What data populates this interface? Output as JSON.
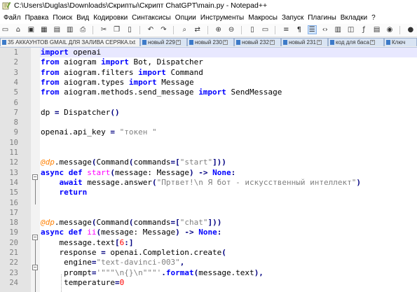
{
  "window": {
    "title": "C:\\Users\\Duglas\\Downloads\\Скрипты\\Скрипт ChatGPT\\main.py - Notepad++"
  },
  "menu": [
    "Файл",
    "Правка",
    "Поиск",
    "Вид",
    "Кодировки",
    "Синтаксисы",
    "Опции",
    "Инструменты",
    "Макросы",
    "Запуск",
    "Плагины",
    "Вкладки",
    "?"
  ],
  "tabs": [
    {
      "label": "35 АККАУНТОВ GMAIL ДЛЯ ЗАЛИВА СЕРЯКА.txt"
    },
    {
      "label": "новый 229"
    },
    {
      "label": "новый 230"
    },
    {
      "label": "новый 232"
    },
    {
      "label": "новый 231"
    },
    {
      "label": "код для баса"
    },
    {
      "label": "Ключ"
    }
  ],
  "editor": {
    "current_line": 1,
    "lines": [
      {
        "n": "1",
        "segs": [
          [
            "kw",
            "import"
          ],
          [
            "id",
            " openai"
          ]
        ]
      },
      {
        "n": "2",
        "segs": [
          [
            "kw",
            "from"
          ],
          [
            "id",
            " aiogram "
          ],
          [
            "kw",
            "import"
          ],
          [
            "id",
            " Bot, Dispatcher"
          ]
        ]
      },
      {
        "n": "3",
        "segs": [
          [
            "kw",
            "from"
          ],
          [
            "id",
            " aiogram.filters "
          ],
          [
            "kw",
            "import"
          ],
          [
            "id",
            " Command"
          ]
        ]
      },
      {
        "n": "4",
        "segs": [
          [
            "kw",
            "from"
          ],
          [
            "id",
            " aiogram.types "
          ],
          [
            "kw",
            "import"
          ],
          [
            "id",
            " Message"
          ]
        ]
      },
      {
        "n": "5",
        "segs": [
          [
            "kw",
            "from"
          ],
          [
            "id",
            " aiogram.methods.send_message "
          ],
          [
            "kw",
            "import"
          ],
          [
            "id",
            " SendMessage"
          ]
        ]
      },
      {
        "n": "6",
        "segs": []
      },
      {
        "n": "7",
        "segs": [
          [
            "id",
            "dp "
          ],
          [
            "op",
            "="
          ],
          [
            "id",
            " Dispatcher"
          ],
          [
            "op",
            "()"
          ]
        ]
      },
      {
        "n": "8",
        "segs": []
      },
      {
        "n": "9",
        "segs": [
          [
            "id",
            "openai.api_key "
          ],
          [
            "op",
            "="
          ],
          [
            "id",
            " "
          ],
          [
            "str",
            "\"токен \""
          ]
        ]
      },
      {
        "n": "10",
        "segs": []
      },
      {
        "n": "11",
        "segs": []
      },
      {
        "n": "12",
        "segs": [
          [
            "dec",
            "@dp"
          ],
          [
            "id",
            ".message"
          ],
          [
            "op",
            "("
          ],
          [
            "id",
            "Command"
          ],
          [
            "op",
            "("
          ],
          [
            "id",
            "commands"
          ],
          [
            "op",
            "=["
          ],
          [
            "str",
            "\"start\""
          ],
          [
            "op",
            "]))"
          ]
        ]
      },
      {
        "n": "13",
        "segs": [
          [
            "kw",
            "async def "
          ],
          [
            "fn",
            "start"
          ],
          [
            "op",
            "("
          ],
          [
            "id",
            "message: Message"
          ],
          [
            "op",
            ") -> "
          ],
          [
            "kw",
            "None"
          ],
          [
            "op",
            ":"
          ]
        ]
      },
      {
        "n": "14",
        "segs": [
          [
            "id",
            "    "
          ],
          [
            "kw",
            "await"
          ],
          [
            "id",
            " message.answer"
          ],
          [
            "op",
            "("
          ],
          [
            "str",
            "\"Пртвет!\\n Я бот - искусственный интеллект\""
          ],
          [
            "op",
            ")"
          ]
        ]
      },
      {
        "n": "15",
        "segs": [
          [
            "id",
            "    "
          ],
          [
            "kw",
            "return"
          ]
        ]
      },
      {
        "n": "16",
        "segs": []
      },
      {
        "n": "17",
        "segs": []
      },
      {
        "n": "18",
        "segs": [
          [
            "dec",
            "@dp"
          ],
          [
            "id",
            ".message"
          ],
          [
            "op",
            "("
          ],
          [
            "id",
            "Command"
          ],
          [
            "op",
            "("
          ],
          [
            "id",
            "commands"
          ],
          [
            "op",
            "=["
          ],
          [
            "str",
            "\"chat\""
          ],
          [
            "op",
            "]))"
          ]
        ]
      },
      {
        "n": "19",
        "segs": [
          [
            "kw",
            "async def "
          ],
          [
            "fn",
            "ii"
          ],
          [
            "op",
            "("
          ],
          [
            "id",
            "message: Message"
          ],
          [
            "op",
            ") -> "
          ],
          [
            "kw",
            "None"
          ],
          [
            "op",
            ":"
          ]
        ]
      },
      {
        "n": "20",
        "segs": [
          [
            "id",
            "    message.text"
          ],
          [
            "op",
            "["
          ],
          [
            "num-lit",
            "6"
          ],
          [
            "op",
            ":]"
          ]
        ]
      },
      {
        "n": "21",
        "segs": [
          [
            "id",
            "    response "
          ],
          [
            "op",
            "="
          ],
          [
            "id",
            " openai.Completion.create"
          ],
          [
            "op",
            "("
          ]
        ]
      },
      {
        "n": "22",
        "segs": [
          [
            "id",
            "     engine"
          ],
          [
            "op",
            "="
          ],
          [
            "str",
            "\"text-davinci-003\""
          ],
          [
            "op",
            ","
          ]
        ]
      },
      {
        "n": "23",
        "segs": [
          [
            "id",
            "     prompt"
          ],
          [
            "op",
            "="
          ],
          [
            "str",
            "'\"\"\"\\n{}\\n\"\"\"'"
          ],
          [
            "op",
            "."
          ],
          [
            "kw",
            "format"
          ],
          [
            "op",
            "("
          ],
          [
            "id",
            "message.text"
          ],
          [
            "op",
            "),"
          ]
        ]
      },
      {
        "n": "24",
        "segs": [
          [
            "id",
            "     temperature"
          ],
          [
            "op",
            "="
          ],
          [
            "num-lit",
            "0"
          ]
        ]
      }
    ]
  }
}
